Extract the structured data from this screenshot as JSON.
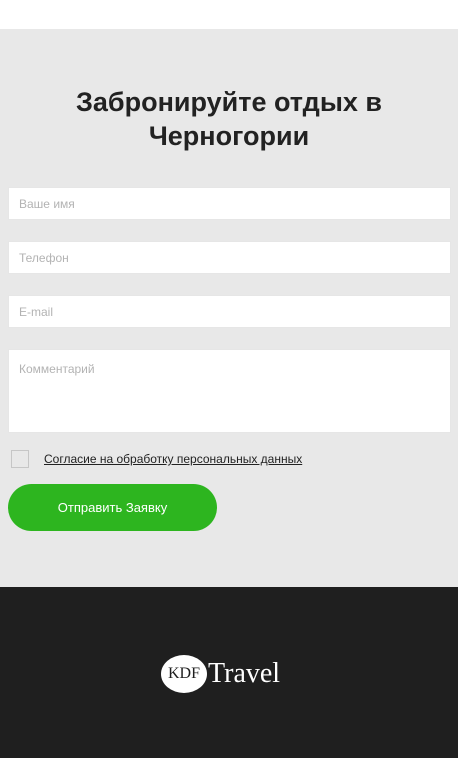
{
  "form": {
    "title": "Забронируйте отдых в Черногории",
    "fields": {
      "name_placeholder": "Ваше имя",
      "phone_placeholder": "Телефон",
      "email_placeholder": "E-mail",
      "comment_placeholder": "Комментарий"
    },
    "consent_label": "Согласие на обработку персональных данных",
    "consent_checked": false,
    "submit_label": "Отправить Заявку"
  },
  "footer": {
    "logo_badge": "KDF",
    "logo_text": "Travel"
  },
  "colors": {
    "section_bg": "#e8e8e8",
    "accent": "#2db51f",
    "footer_bg": "#1f1f1f"
  }
}
